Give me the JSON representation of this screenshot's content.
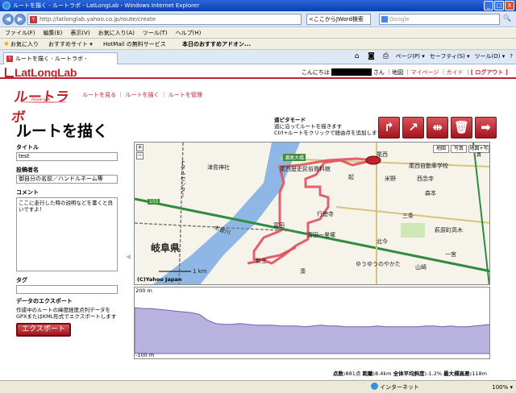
{
  "window": {
    "title": "ルートを描く - ルートラボ - LatLongLab - Windows Internet Explorer",
    "btn_min": "_",
    "btn_max": "□",
    "btn_close": "X"
  },
  "addressbar": {
    "back": "◀",
    "forward": "▶",
    "url": "http://latlonglab.yahoo.co.jp/route/create",
    "search_label": "<ここからJWord検索",
    "search_placeholder": "Google",
    "search_go": "🔍"
  },
  "menu": [
    "ファイル(F)",
    "編集(E)",
    "表示(V)",
    "お気に入り(A)",
    "ツール(T)",
    "ヘルプ(H)"
  ],
  "favorites": {
    "favorites_label": "お気に入り",
    "items": [
      "おすすめサイト ▾",
      "HotMail の無料サービス",
      "本日のおすすめアドオン..."
    ]
  },
  "tab": {
    "label": "ルートを描く - ルートラボ - LatLongLab"
  },
  "commands": [
    "ページ(P) ▾",
    "セーフティ(S) ▾",
    "ツール(O) ▾",
    "?"
  ],
  "site": {
    "logo": "LatLongLab",
    "greeting_prefix": "こんにちは",
    "greeting_suffix": "さん",
    "link_map": "地図",
    "link_mypage": "マイページ",
    "link_guide": "ガイド",
    "link_logout": "[ ログアウト ]"
  },
  "routelab": {
    "logo": "ルートラボ",
    "tagline": "Route Lab",
    "nav": [
      "ルートを見る",
      "ルートを描く",
      "ルートを管理"
    ]
  },
  "page": {
    "title": "ルートを描く"
  },
  "mode": {
    "title": "道ピタモード",
    "line1": "道に沿ってルートを描きます",
    "line2": "Ctrl+ルートをクリックで経由点を追加します"
  },
  "form": {
    "title_label": "タイトル",
    "title_value": "test",
    "author_label": "投稿者名",
    "author_value": "御自分の名前／ハンドルネーム等",
    "comment_label": "コメント",
    "comment_value": "ここに走行した時の説明などを書くと良いですよ！",
    "tag_label": "タグ",
    "tag_value": "",
    "export_heading": "データのエクスポート",
    "export_desc": "作成中のルートの緯度経度点列データをGPXまたはKML形式でエクスポートします",
    "export_button": "エクスポート"
  },
  "map": {
    "zoom_in": "+",
    "zoom_out": "−",
    "type_map": "地図",
    "type_photo": "写真",
    "type_both": "地図+写真",
    "labels": {
      "prefecture": "岐阜県",
      "station_nishi": "尾西",
      "museum": "尾西歴史民俗資料館",
      "school": "尾西自動車学校",
      "yoneno": "米野",
      "okoshi": "起",
      "ichinomiya": "一宮",
      "gyotokuji": "行徳寺",
      "tomida": "富田",
      "tomida_ichiri": "富田一里塚",
      "shinsei": "新生",
      "saienji": "西念寺",
      "morimoto": "森本",
      "sannose": "三条",
      "hagiwara": "萩原町高木",
      "yuyu": "ゆうゆうのやかた",
      "yamazaki": "山崎",
      "river_bridge": "濃尾大橋",
      "kisogawa": "木曽川",
      "kitacho": "北今",
      "minato": "湊",
      "toaru": "トタルセンター",
      "tsushima": "津島神社",
      "road_155": "155",
      "scale": "1 km",
      "copyright": "(C)Yahoo Japan"
    }
  },
  "elevation": {
    "top_label": "200 m",
    "bottom_label": "-100 m",
    "profile": [
      55,
      54,
      54,
      53,
      52,
      51,
      50,
      49,
      47,
      40,
      36,
      35,
      35,
      36,
      35,
      34,
      34,
      34,
      33,
      33,
      33,
      32,
      33,
      34,
      33,
      33,
      32,
      32,
      32,
      32,
      33,
      32,
      32,
      32,
      32,
      32,
      33,
      33,
      32,
      33,
      32,
      32,
      33,
      34,
      35
    ]
  },
  "stats": {
    "points_label": "点数:",
    "points_value": "881点",
    "distance_label": "距離:",
    "distance_value": "8.4km",
    "grade_label": "全体平均斜度:",
    "grade_value": "-1.2%",
    "maxalt_label": "最大標高差:",
    "maxalt_value": "118m"
  },
  "status": {
    "network": "インターネット",
    "zoom": "100% ▾"
  },
  "colors": {
    "brand_red": "#c0232b",
    "route": "#e0505c",
    "river": "#8fb7e6",
    "main_road": "#2e8b3f"
  }
}
